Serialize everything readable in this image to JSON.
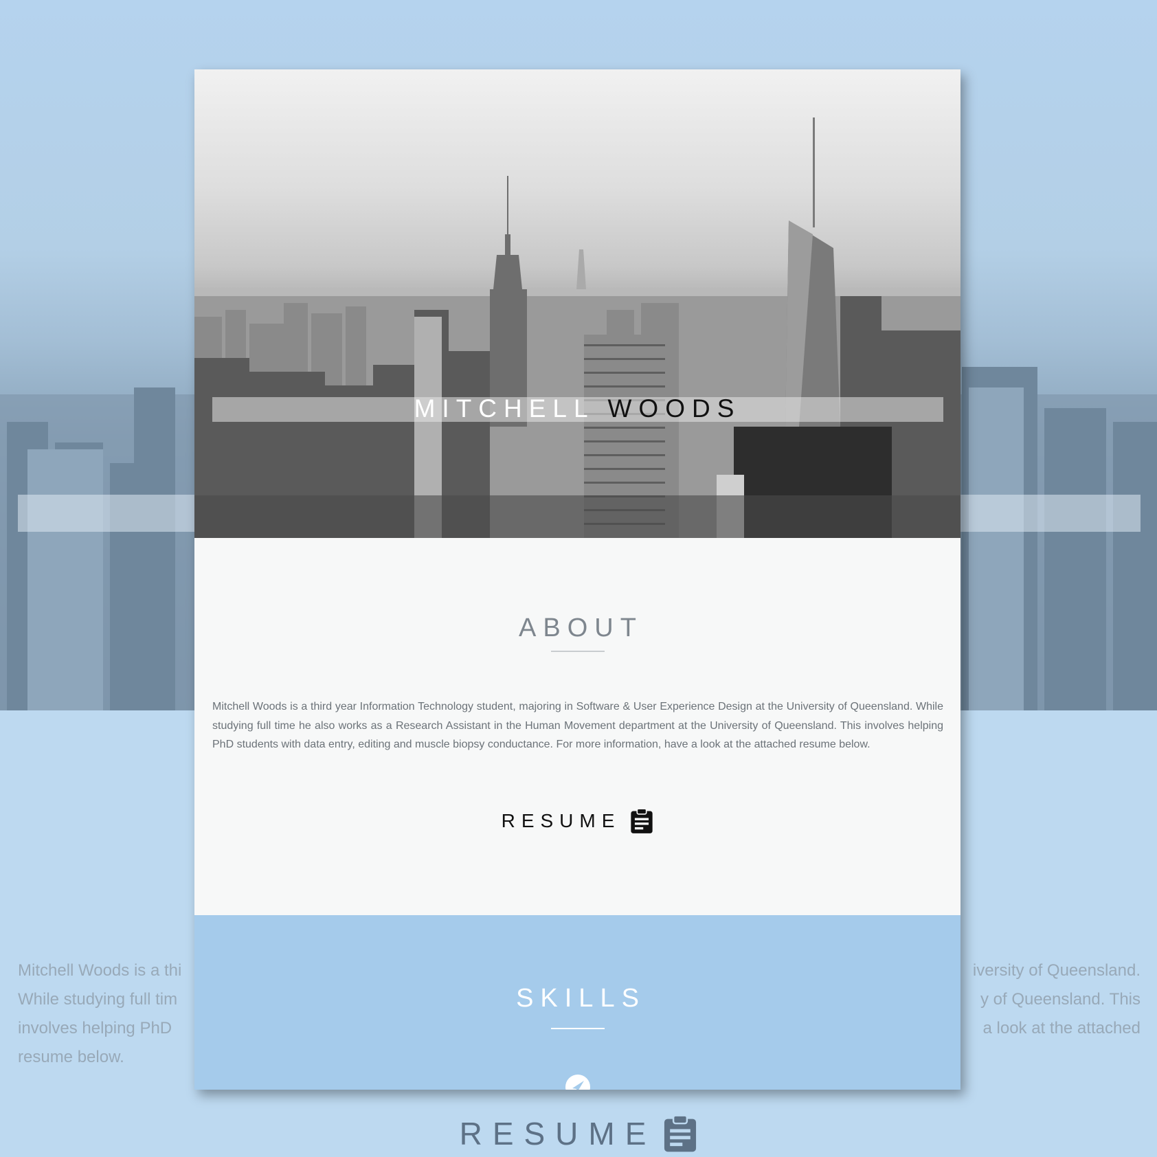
{
  "page": {
    "name_first": "MITCHELL",
    "name_last": "WOODS"
  },
  "about": {
    "title": "ABOUT",
    "text": "Mitchell Woods is a third year Information Technology student, majoring in Software & User Experience Design at the University of Queensland. While studying full time he also works as a Research Assistant in the Human Movement department at the University of Queensland. This involves helping PhD students with data entry, editing and muscle biopsy conductance. For more information, have a look at the attached resume below.",
    "resume_label": "RESUME"
  },
  "skills": {
    "title": "SKILLS"
  },
  "background": {
    "para_left_1": "Mitchell Woods is a thi",
    "para_left_2": "While studying full tim",
    "para_left_3": "involves helping PhD",
    "para_left_4": "resume below.",
    "para_right_1": "iversity of Queensland.",
    "para_right_2": "y of Queensland. This",
    "para_right_3": "a look at the attached",
    "resume_label": "RESUME"
  },
  "colors": {
    "page_bg": "#bcd7ee",
    "skills_bg": "#a5cbeb",
    "card_bg": "#f7f8f8"
  },
  "icons": {
    "resume": "clipboard-icon",
    "skills": "paper-plane-icon"
  }
}
